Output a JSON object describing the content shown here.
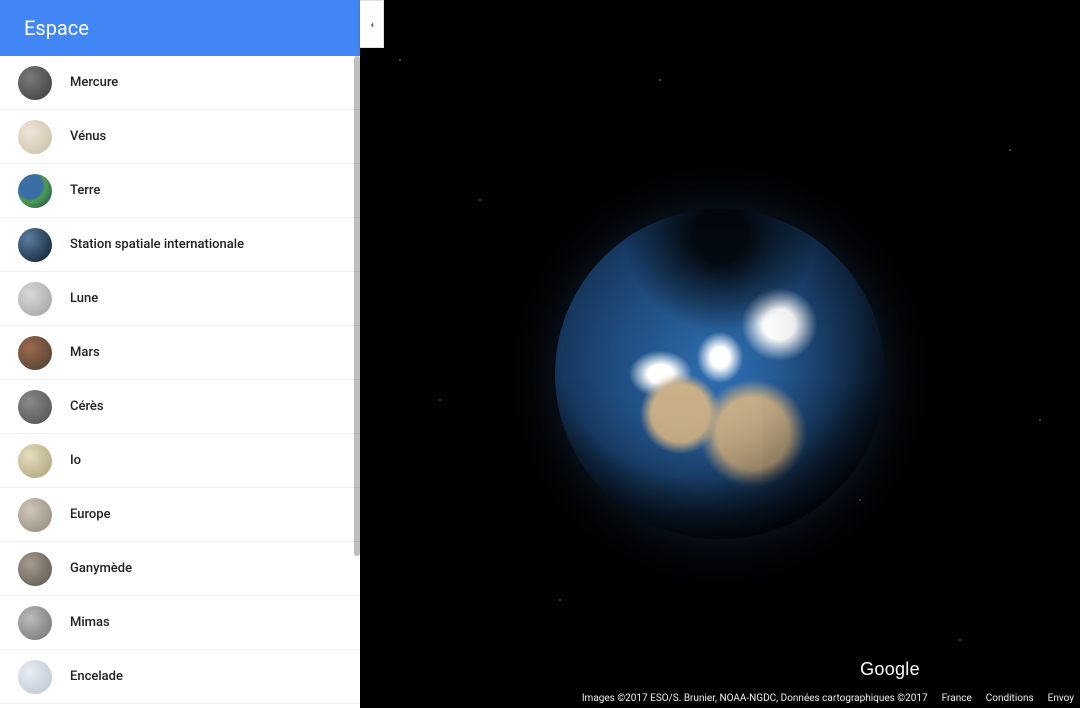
{
  "sidebar": {
    "title": "Espace",
    "items": [
      {
        "label": "Mercure",
        "thumb": "p-mercure"
      },
      {
        "label": "Vénus",
        "thumb": "p-venus"
      },
      {
        "label": "Terre",
        "thumb": "p-terre"
      },
      {
        "label": "Station spatiale internationale",
        "thumb": "p-iss"
      },
      {
        "label": "Lune",
        "thumb": "p-lune"
      },
      {
        "label": "Mars",
        "thumb": "p-mars"
      },
      {
        "label": "Cérès",
        "thumb": "p-ceres"
      },
      {
        "label": "Io",
        "thumb": "p-io"
      },
      {
        "label": "Europe",
        "thumb": "p-europe"
      },
      {
        "label": "Ganymède",
        "thumb": "p-ganymede"
      },
      {
        "label": "Mimas",
        "thumb": "p-mimas"
      },
      {
        "label": "Encelade",
        "thumb": "p-encelade"
      }
    ]
  },
  "brand": "Google",
  "footer": {
    "imagery": "Images ©2017 ESO/S. Brunier, NOAA-NGDC, Données cartographiques ©2017",
    "links": [
      "France",
      "Conditions",
      "Envoy"
    ]
  }
}
